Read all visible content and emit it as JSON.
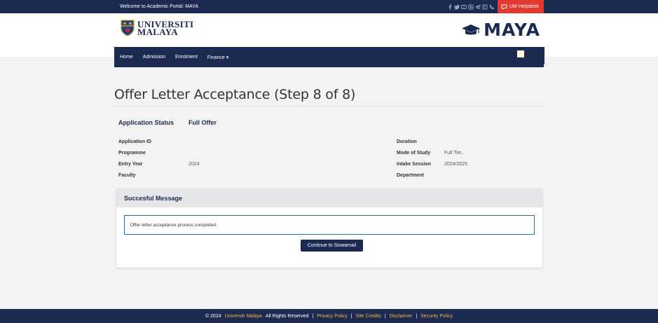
{
  "topbar": {
    "welcome": "Welcome to Academic Portal: MAYA",
    "social_icons": [
      "facebook-icon",
      "twitter-icon",
      "youtube-icon",
      "instagram-icon",
      "telegram-icon",
      "tiktok-icon",
      "phone-icon"
    ],
    "helpdesk_label": "UM Helpdesk"
  },
  "header": {
    "university_line1": "UNIVERSITI",
    "university_line2": "MALAYA",
    "maya_label": "MAYA"
  },
  "nav": {
    "items": [
      {
        "label": "Home"
      },
      {
        "label": "Admission"
      },
      {
        "label": "Enrolment"
      },
      {
        "label": "Finance ▾"
      }
    ]
  },
  "page": {
    "title": "Offer Letter Acceptance (Step 8 of 8)"
  },
  "status": {
    "label": "Application Status",
    "value": "Full Offer"
  },
  "fields_left": [
    {
      "label": "Application ID",
      "value": ""
    },
    {
      "label": "Programme",
      "value": ""
    },
    {
      "label": "Entry Year",
      "value": "2024"
    },
    {
      "label": "Faculty",
      "value": ""
    }
  ],
  "fields_right": [
    {
      "label": "Duration",
      "value": ""
    },
    {
      "label": "Mode of Study",
      "value": "Full Tim.."
    },
    {
      "label": "Intake Session",
      "value": "2024/2025"
    },
    {
      "label": "Department",
      "value": ""
    }
  ],
  "card": {
    "title": "Succesful Message",
    "message": "Offer letter acceptance process completed.",
    "button_label": "Continue to Siswamail"
  },
  "footer": {
    "copyright": "© 2024",
    "university": "Universiti Malaya",
    "rights": "All Rights Reserved",
    "links": [
      "Privacy Policy",
      "Site Credits",
      "Disclaimer",
      "Security Policy"
    ]
  },
  "colors": {
    "navy": "#1c2a52",
    "helpdesk_red": "#e23a2f",
    "footer_link": "#f2b73b",
    "message_border": "#2f6fa8"
  }
}
